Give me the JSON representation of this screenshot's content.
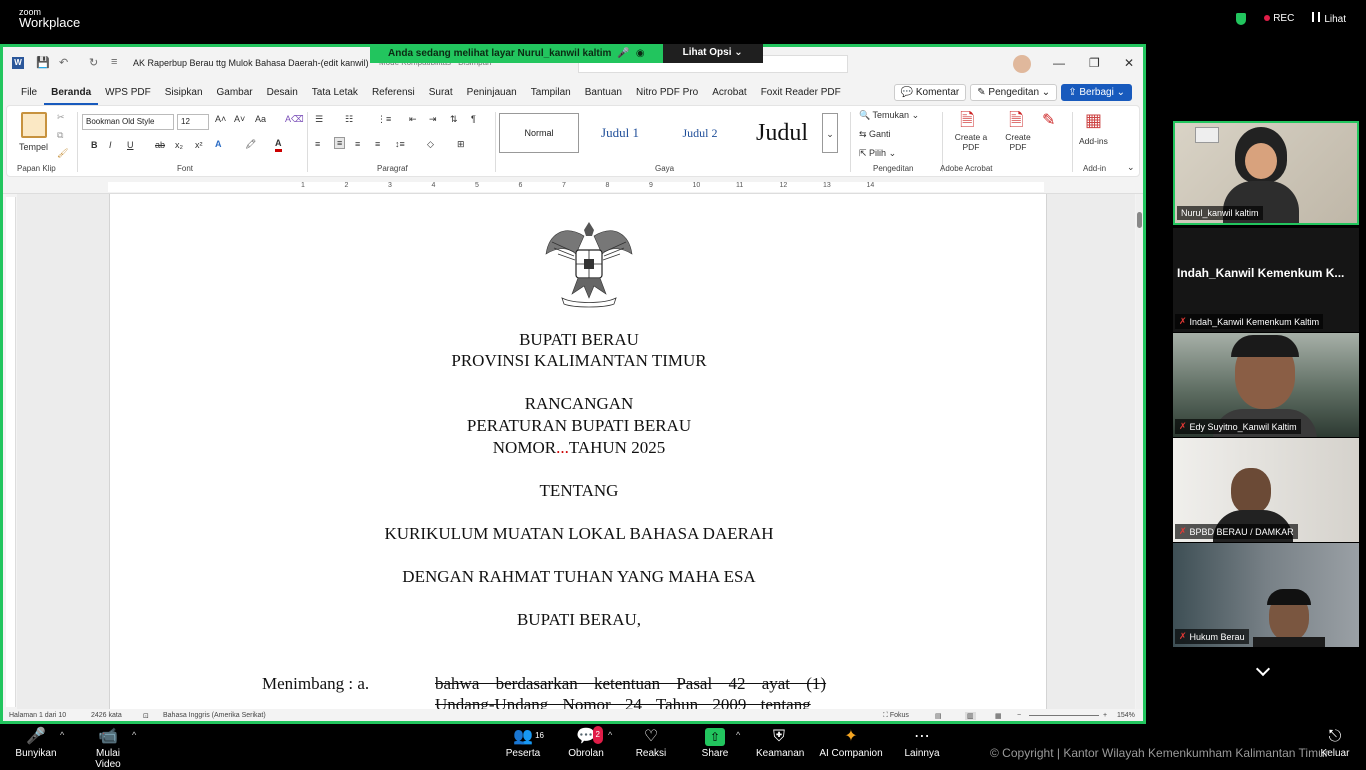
{
  "zoom": {
    "logo_small": "zoom",
    "logo_big": "Workplace",
    "rec_label": "REC",
    "view_label": "Lihat",
    "share_banner": "Anda sedang melihat layar  Nurul_kanwil kaltim",
    "view_options": "Lihat Opsi"
  },
  "word": {
    "doc_title": "AK Raperbup Berau ttg Mulok Bahasa Daerah-(edit kanwil)",
    "doc_title_extra": "Mode Kompatibilitas · Disimpan",
    "menu": [
      "File",
      "Beranda",
      "WPS PDF",
      "Sisipkan",
      "Gambar",
      "Desain",
      "Tata Letak",
      "Referensi",
      "Surat",
      "Peninjauan",
      "Tampilan",
      "Bantuan",
      "Nitro PDF Pro",
      "Acrobat",
      "Foxit Reader PDF"
    ],
    "menu_active": "Beranda",
    "comment_btn": "Komentar",
    "editing_btn": "Pengeditan",
    "share_btn": "Berbagi",
    "ribbon": {
      "paste": "Tempel",
      "font_name": "Bookman Old Style",
      "font_size": "12",
      "styles": [
        "Normal",
        "Judul 1",
        "Judul 2",
        "Judul"
      ],
      "find": "Temukan",
      "replace": "Ganti",
      "select": "Pilih",
      "create_a_pdf": "Create a PDF",
      "create_pdf": "Create PDF",
      "add_ins": "Add-ins",
      "groups": [
        "Papan Klip",
        "Font",
        "Paragraf",
        "Gaya",
        "Pengeditan",
        "Adobe Acrobat",
        "Add-in"
      ]
    },
    "ruler_numbers": [
      "1",
      "2",
      "3",
      "4",
      "5",
      "6",
      "7",
      "8",
      "9",
      "10",
      "11",
      "12",
      "13",
      "14"
    ],
    "document": {
      "line1": "BUPATI BERAU",
      "line2": "PROVINSI KALIMANTAN TIMUR",
      "line3": "RANCANGAN",
      "line4": "PERATURAN BUPATI BERAU",
      "line5_a": "NOMOR",
      "line5_dots": "...",
      "line5_b": "TAHUN 2025",
      "line6": "TENTANG",
      "line7": "KURIKULUM MUATAN LOKAL BAHASA DAERAH",
      "line8": "DENGAN RAHMAT TUHAN YANG MAHA ESA",
      "line9": "BUPATI BERAU,",
      "menimbang": "Menimbang  :    a.",
      "menimbang_text": "bahwa berdasarkan ketentuan Pasal 42 ayat (1)",
      "next_line": "Undang-Undang Nomor 24 Tahun 2009 tentang"
    },
    "status": {
      "page": "Halaman 1 dari 10",
      "words": "2426 kata",
      "language": "Bahasa Inggris (Amerika Serikat)",
      "focus": "Fokus",
      "zoom": "154%"
    }
  },
  "participants": [
    {
      "name": "Nurul_kanwil kaltim",
      "muted": false
    },
    {
      "name": "Indah_Kanwil Kemenkum Kaltim",
      "big": "Indah_Kanwil Kemenkum K...",
      "muted": true
    },
    {
      "name": "Edy Suyitno_Kanwil Kaltim",
      "muted": true
    },
    {
      "name": "BPBD BERAU / DAMKAR",
      "muted": true
    },
    {
      "name": "Hukum Berau",
      "muted": true
    }
  ],
  "toolbar": {
    "mute": "Bunyikan",
    "video": "Mulai Video",
    "participants": "Peserta",
    "participants_count": "16",
    "chat": "Obrolan",
    "chat_badge": "2",
    "reactions": "Reaksi",
    "share": "Share",
    "security": "Keamanan",
    "ai": "AI Companion",
    "more": "Lainnya",
    "leave": "Keluar",
    "copyright": "© Copyright | Kantor Wilayah Kemenkumham Kalimantan Timur"
  },
  "colors": {
    "share_green": "#22c55e",
    "word_blue": "#185abd",
    "red_dots": "#cc0000"
  }
}
